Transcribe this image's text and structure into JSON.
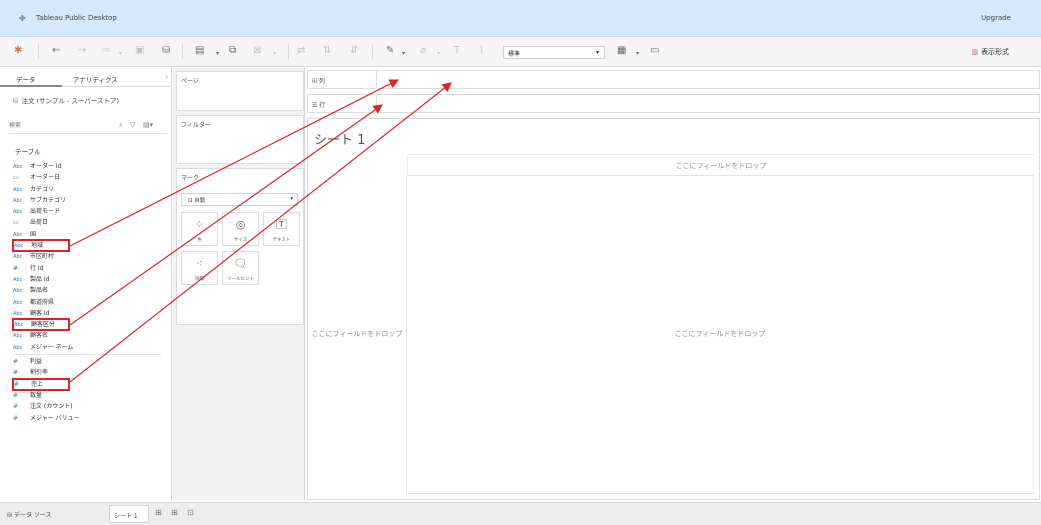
{
  "titlebar": {
    "app_icon": "tableau-logo-icon",
    "title": "Tableau Public Desktop",
    "upgrade": "Upgrade"
  },
  "toolbar": {
    "format_dropdown": "標準",
    "show_me": "表示形式"
  },
  "left_panel": {
    "tab_data": "データ",
    "tab_analytics": "アナリティクス",
    "collapse": "‹",
    "datasource": "注文 (サンプル - スーパーストア)",
    "search_placeholder": "検索",
    "tables_heading": "テーブル",
    "dimensions": [
      {
        "type": "Abc",
        "name": "オーダー Id"
      },
      {
        "type": "date",
        "name": "オーダー日"
      },
      {
        "type": "Abc",
        "name": "カテゴリ"
      },
      {
        "type": "Abc",
        "name": "サブカテゴリ"
      },
      {
        "type": "Abc",
        "name": "出荷モード"
      },
      {
        "type": "date",
        "name": "出荷日"
      },
      {
        "type": "Abc",
        "name": "国"
      },
      {
        "type": "Abc",
        "name": "地域",
        "highlight": true
      },
      {
        "type": "Abc",
        "name": "市区町村"
      },
      {
        "type": "#",
        "name": "行 Id"
      },
      {
        "type": "Abc",
        "name": "製品 Id"
      },
      {
        "type": "Abc",
        "name": "製品名"
      },
      {
        "type": "Abc",
        "name": "都道府県"
      },
      {
        "type": "Abc",
        "name": "顧客 Id"
      },
      {
        "type": "Abc",
        "name": "顧客区分",
        "highlight": true
      },
      {
        "type": "Abc",
        "name": "顧客名"
      },
      {
        "type": "Abc",
        "name": "メジャー ネーム"
      }
    ],
    "measures": [
      {
        "type": "#",
        "name": "利益"
      },
      {
        "type": "#",
        "name": "割引率"
      },
      {
        "type": "#",
        "name": "売上",
        "highlight": true
      },
      {
        "type": "#",
        "name": "数量"
      },
      {
        "type": "#",
        "name": "注文 (カウント)"
      },
      {
        "type": "#",
        "name": "メジャー バリュー"
      }
    ]
  },
  "mid_panel": {
    "pages": "ページ",
    "filters": "フィルター",
    "marks": "マーク",
    "marks_type": "自動",
    "mark_buttons": [
      "色",
      "サイズ",
      "テキスト",
      "詳細",
      "ツールヒント"
    ]
  },
  "shelves": {
    "columns": "列",
    "rows": "行"
  },
  "canvas": {
    "sheet_title": "シート 1",
    "drop_top": "ここにフィールドをドロップ",
    "drop_left": "ここにフィールドをドロップ",
    "drop_main": "ここにフィールドをドロップ"
  },
  "statusbar": {
    "datasource_tab": "データ ソース",
    "sheet_tab": "シート 1"
  },
  "colors": {
    "annotation": "#d9232d",
    "titlebar_bg": "#d6e8fb"
  }
}
